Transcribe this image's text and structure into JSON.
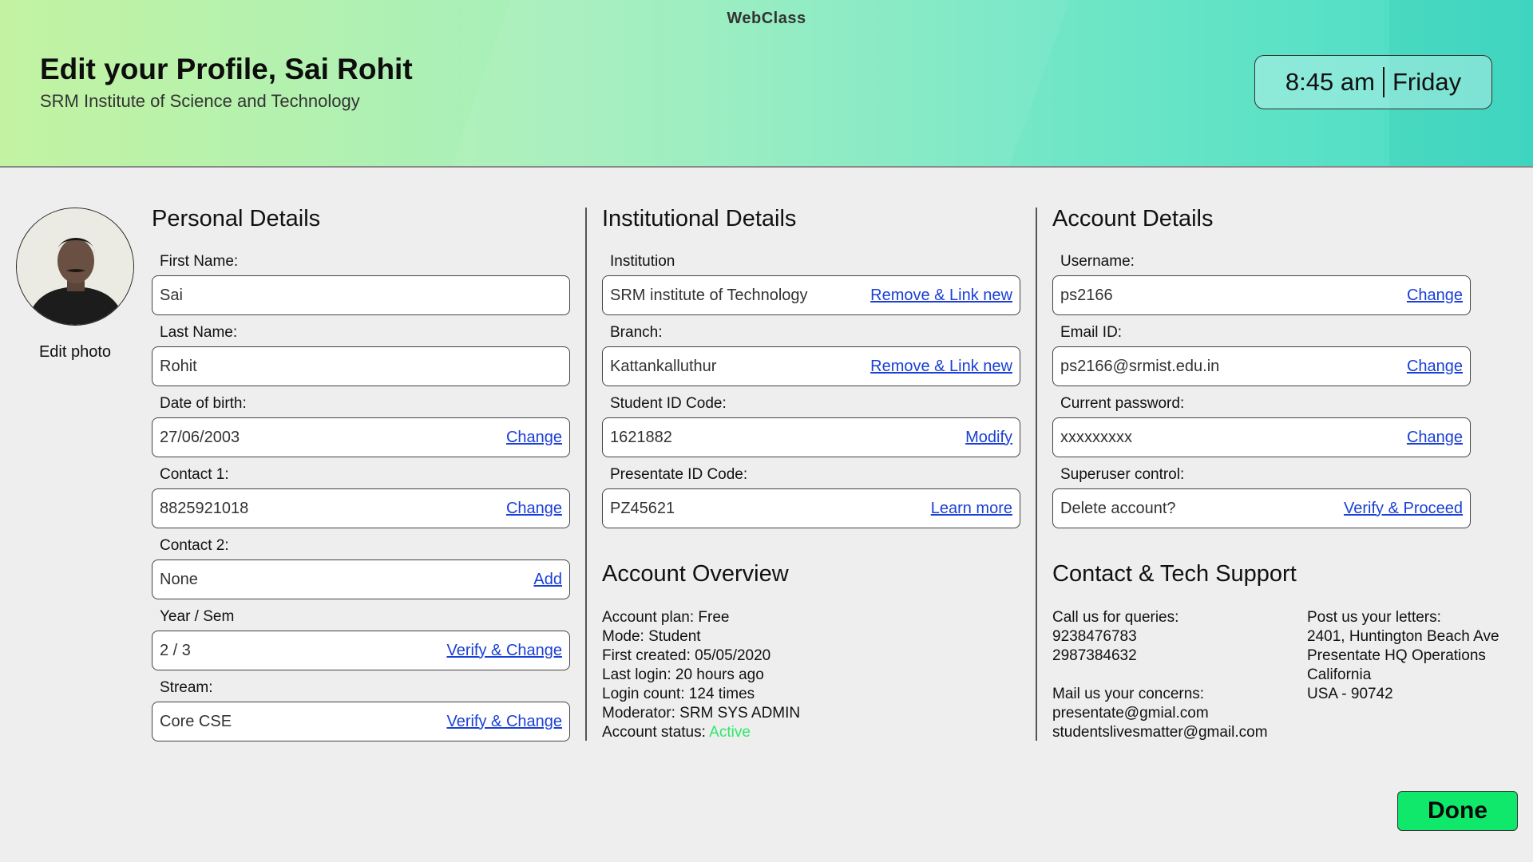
{
  "app_title": "WebClass",
  "header": {
    "title": "Edit your Profile, Sai Rohit",
    "subtitle": "SRM Institute of Science and Technology",
    "clock_time": "8:45 am",
    "clock_day": "Friday"
  },
  "profile": {
    "edit_photo": "Edit photo"
  },
  "personal": {
    "title": "Personal Details",
    "fields": [
      {
        "label": "First Name:",
        "value": "Sai",
        "action": ""
      },
      {
        "label": "Last Name:",
        "value": "Rohit",
        "action": ""
      },
      {
        "label": "Date of birth:",
        "value": "27/06/2003",
        "action": "Change"
      },
      {
        "label": "Contact 1:",
        "value": "8825921018",
        "action": "Change"
      },
      {
        "label": "Contact 2:",
        "value": "None",
        "action": "Add"
      },
      {
        "label": "Year / Sem",
        "value": "2 / 3",
        "action": "Verify & Change"
      },
      {
        "label": "Stream:",
        "value": "Core CSE",
        "action": "Verify & Change"
      }
    ]
  },
  "institutional": {
    "title": "Institutional Details",
    "fields": [
      {
        "label": "Institution",
        "value": "SRM institute of Technology",
        "action": "Remove & Link new"
      },
      {
        "label": "Branch:",
        "value": "Kattankalluthur",
        "action": "Remove & Link new"
      },
      {
        "label": "Student ID Code:",
        "value": "1621882",
        "action": "Modify"
      },
      {
        "label": "Presentate ID Code:",
        "value": "PZ45621",
        "action": "Learn more"
      }
    ]
  },
  "account": {
    "title": "Account Details",
    "fields": [
      {
        "label": "Username:",
        "value": "ps2166",
        "action": "Change"
      },
      {
        "label": "Email ID:",
        "value": "ps2166@srmist.edu.in",
        "action": "Change"
      },
      {
        "label": "Current password:",
        "value": "xxxxxxxxx",
        "action": "Change"
      },
      {
        "label": "Superuser control:",
        "value": "Delete account?",
        "action": "Verify & Proceed"
      }
    ]
  },
  "overview": {
    "title": "Account Overview",
    "lines": [
      "Account plan: Free",
      "Mode: Student",
      "First created: 05/05/2020",
      "Last login: 20 hours ago",
      "Login count: 124 times",
      "Moderator: SRM SYS ADMIN"
    ],
    "status_label": "Account status:",
    "status_value": "Active",
    "status_color": "#2ee86a"
  },
  "support": {
    "title": "Contact & Tech Support",
    "call_label": "Call us for queries:",
    "phones": [
      "9238476783",
      "2987384632"
    ],
    "mail_label": "Mail us your concerns:",
    "emails": [
      "presentate@gmial.com",
      "studentslivesmatter@gmail.com"
    ],
    "post_label": "Post us your letters:",
    "address": [
      "2401, Huntington Beach Ave",
      "Presentate HQ Operations",
      "California",
      "USA - 90742"
    ]
  },
  "done_label": "Done",
  "colors": {
    "link": "#1a3fd6",
    "done_button": "#0fe86a",
    "active_status": "#2ee86a"
  }
}
